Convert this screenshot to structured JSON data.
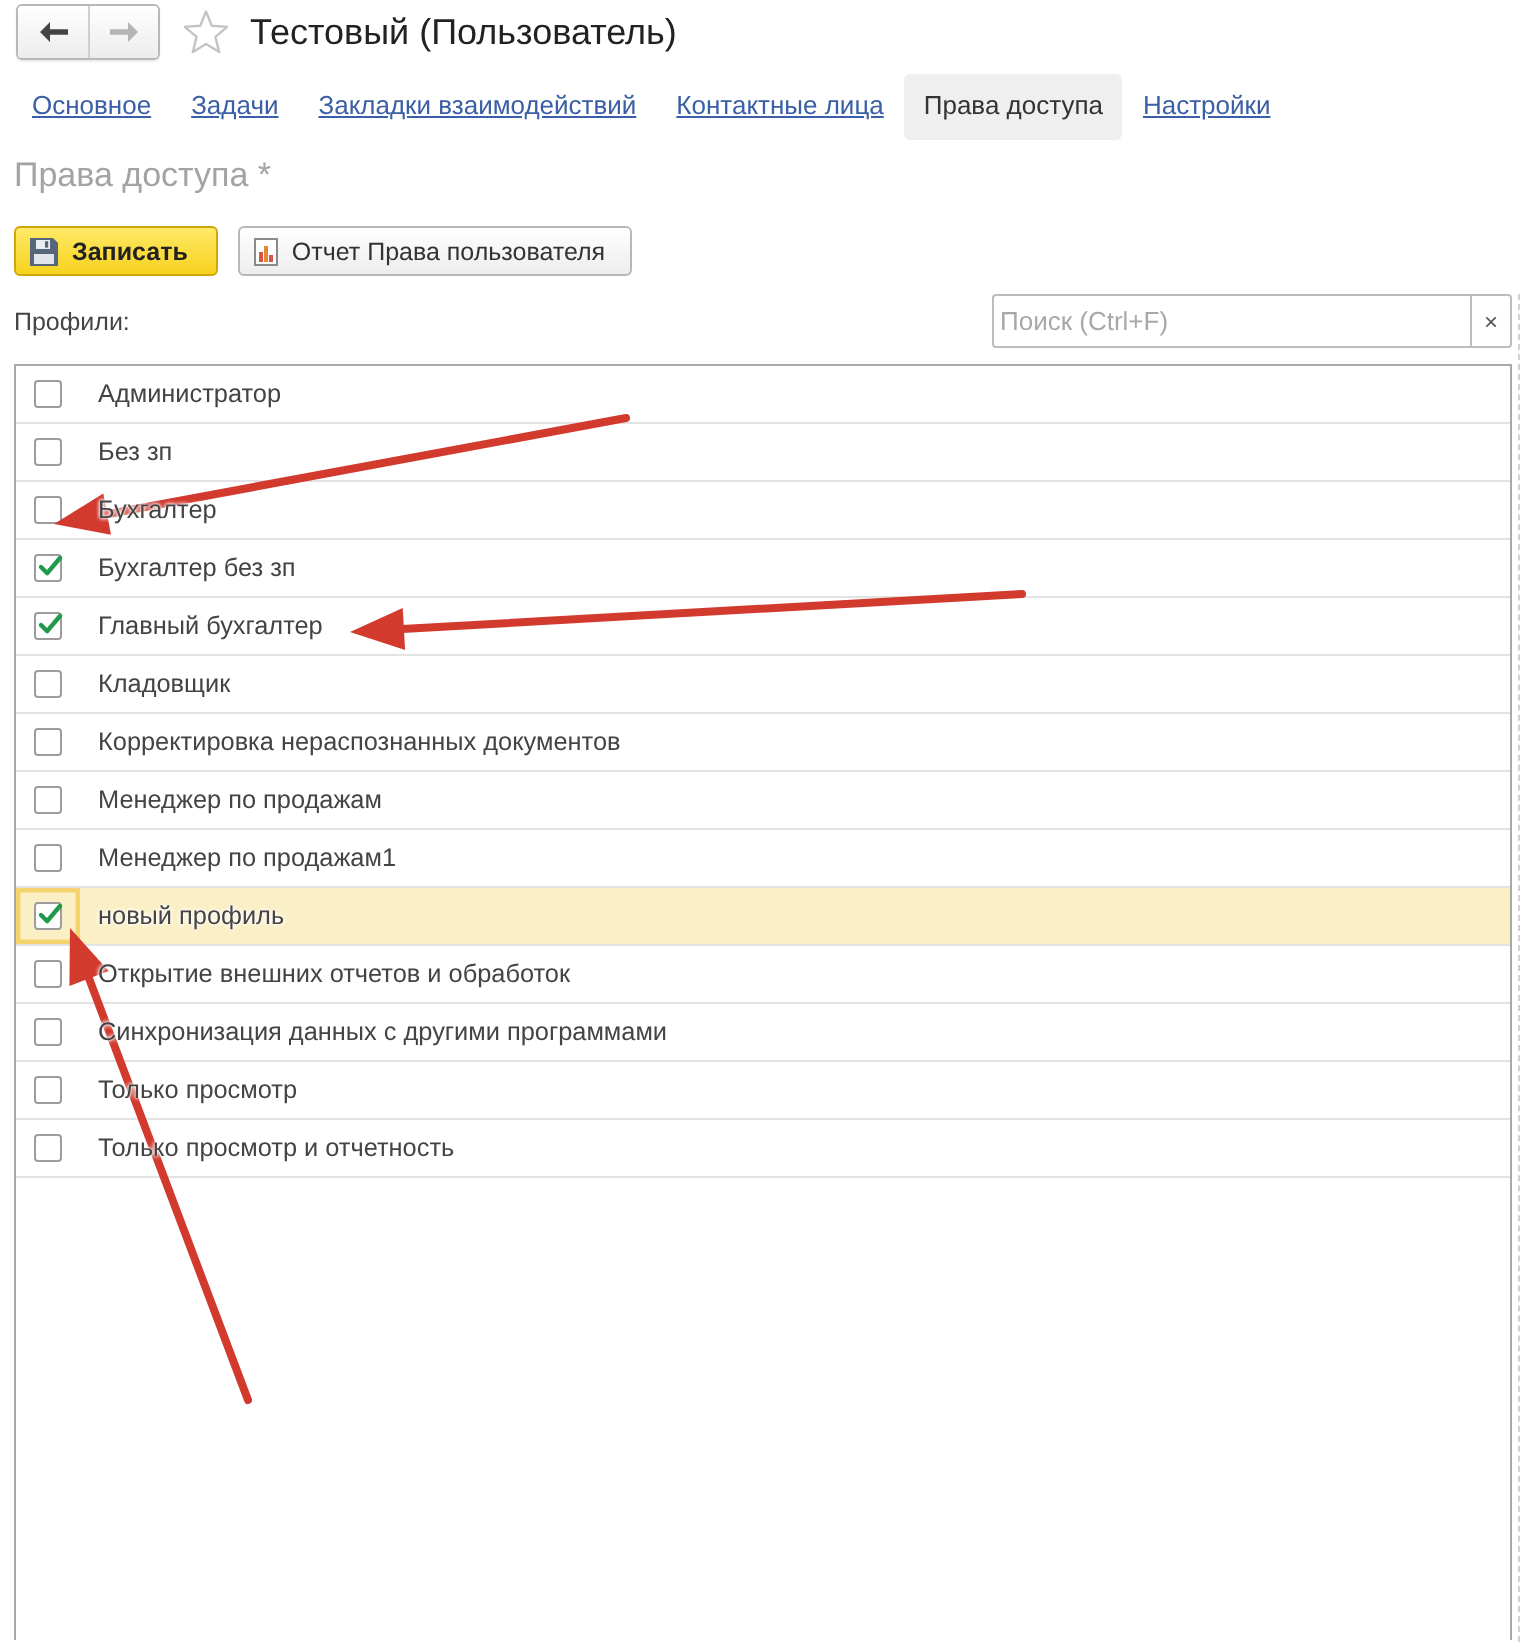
{
  "window": {
    "title": "Тестовый (Пользователь)",
    "starred": false,
    "back_disabled": false,
    "forward_disabled": true
  },
  "tabs": [
    {
      "label": "Основное",
      "selected": false
    },
    {
      "label": "Задачи",
      "selected": false
    },
    {
      "label": "Закладки взаимодействий",
      "selected": false
    },
    {
      "label": "Контактные лица",
      "selected": false
    },
    {
      "label": "Права доступа",
      "selected": true
    },
    {
      "label": "Настройки",
      "selected": false
    }
  ],
  "section_title": "Права доступа *",
  "toolbar": [
    {
      "label": "Записать",
      "kind": "save"
    },
    {
      "label": "Отчет Права пользователя",
      "kind": "report"
    }
  ],
  "profiles": {
    "label": "Профили:",
    "search": {
      "placeholder": "Поиск (Ctrl+F)",
      "clear": "×"
    },
    "rows": [
      {
        "name": "Администратор",
        "checked": false,
        "selected": false
      },
      {
        "name": "Без зп",
        "checked": false,
        "selected": false
      },
      {
        "name": "Бухгалтер",
        "checked": false,
        "selected": false
      },
      {
        "name": "Бухгалтер без зп",
        "checked": true,
        "selected": false
      },
      {
        "name": "Главный бухгалтер",
        "checked": true,
        "selected": false
      },
      {
        "name": "Кладовщик",
        "checked": false,
        "selected": false
      },
      {
        "name": "Корректировка нераспознанных документов",
        "checked": false,
        "selected": false
      },
      {
        "name": "Менеджер по продажам",
        "checked": false,
        "selected": false
      },
      {
        "name": "Менеджер по продажам1",
        "checked": false,
        "selected": false
      },
      {
        "name": "новый профиль",
        "checked": true,
        "selected": true
      },
      {
        "name": "Открытие внешних отчетов и обработок",
        "checked": false,
        "selected": false
      },
      {
        "name": "Синхронизация данных с другими программами",
        "checked": false,
        "selected": false
      },
      {
        "name": "Только просмотр",
        "checked": false,
        "selected": false
      },
      {
        "name": "Только просмотр и отчетность",
        "checked": false,
        "selected": false
      }
    ]
  }
}
